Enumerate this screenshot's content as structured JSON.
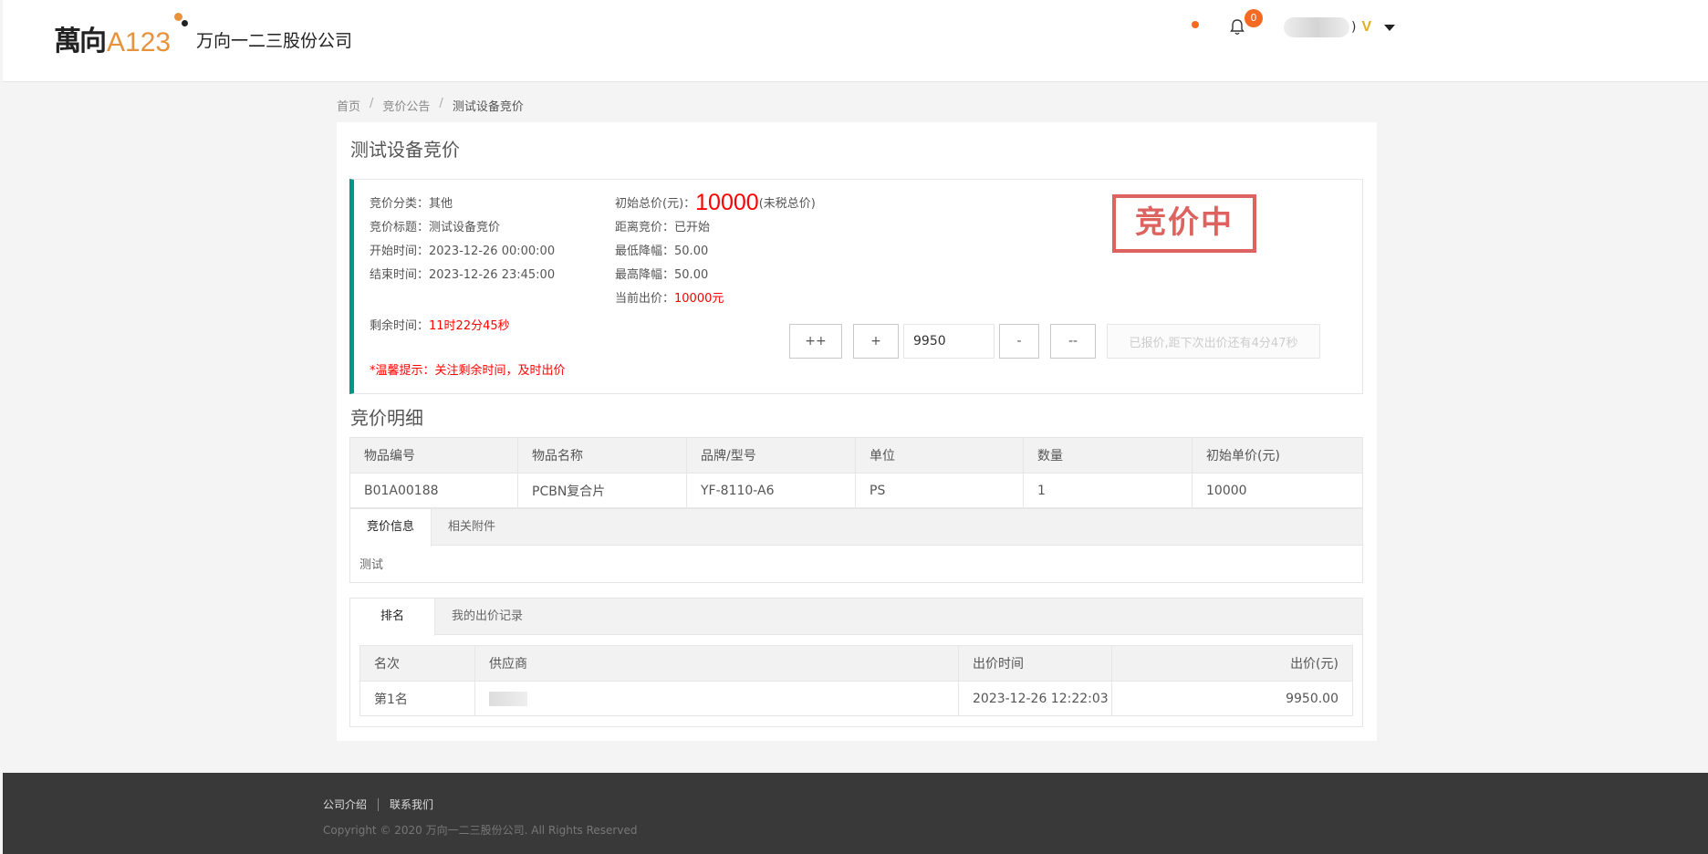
{
  "header": {
    "logo_kanji": "萬向",
    "logo_a123": "A123",
    "company_name": "万向一二三股份公司",
    "notification_count": "0",
    "user_suffix": ")",
    "vip_mark": "V"
  },
  "breadcrumb": {
    "home": "首页",
    "sep": "/",
    "announcements": "竞价公告",
    "current": "测试设备竞价"
  },
  "page_title": "测试设备竞价",
  "info": {
    "category_label": "竞价分类：",
    "category_value": "其他",
    "title_label": "竞价标题：",
    "title_value": "测试设备竞价",
    "start_label": "开始时间：",
    "start_value": "2023-12-26 00:00:00",
    "end_label": "结束时间：",
    "end_value": "2023-12-26 23:45:00",
    "remaining_label": "剩余时间：",
    "remaining_value": "11时22分45秒",
    "tip": "*温馨提示：关注剩余时间，及时出价",
    "initial_total_label": "初始总价(元)：",
    "initial_total_value": "10000",
    "initial_total_note": "(未税总价)",
    "distance_label": "距离竞价：",
    "distance_value": "已开始",
    "min_drop_label": "最低降幅：",
    "min_drop_value": "50.00",
    "max_drop_label": "最高降幅：",
    "max_drop_value": "50.00",
    "current_bid_label": "当前出价：",
    "current_bid_value": "10000元",
    "stamp": "竞价中"
  },
  "bid": {
    "btn_plus_plus": "++",
    "btn_plus": "+",
    "input_value": "9950",
    "btn_minus": "-",
    "btn_minus_minus": "--",
    "btn_submit_disabled": "已报价,距下次出价还有4分47秒"
  },
  "detail_title": "竞价明细",
  "items_table": {
    "headers": [
      "物品编号",
      "物品名称",
      "品牌/型号",
      "单位",
      "数量",
      "初始单价(元)"
    ],
    "rows": [
      [
        "B01A00188",
        "PCBN复合片",
        "YF-8110-A6",
        "PS",
        "1",
        "10000"
      ]
    ]
  },
  "tabs1": {
    "tabs": [
      "竞价信息",
      "相关附件"
    ],
    "content": "测试"
  },
  "tabs2": {
    "tabs": [
      "排名",
      "我的出价记录"
    ],
    "headers": [
      "名次",
      "供应商",
      "出价时间",
      "出价(元)"
    ],
    "rows": [
      [
        "第1名",
        "",
        "2023-12-26 12:22:03",
        "9950.00"
      ]
    ]
  },
  "footer": {
    "about": "公司介绍",
    "contact": "联系我们",
    "copyright": "Copyright © 2020 万向一二三股份公司. All Rights Reserved"
  },
  "colors": {
    "accent_teal": "#009688",
    "price_red": "#ff0000",
    "badge_orange": "#f26a23",
    "footer_bg": "#393939"
  }
}
